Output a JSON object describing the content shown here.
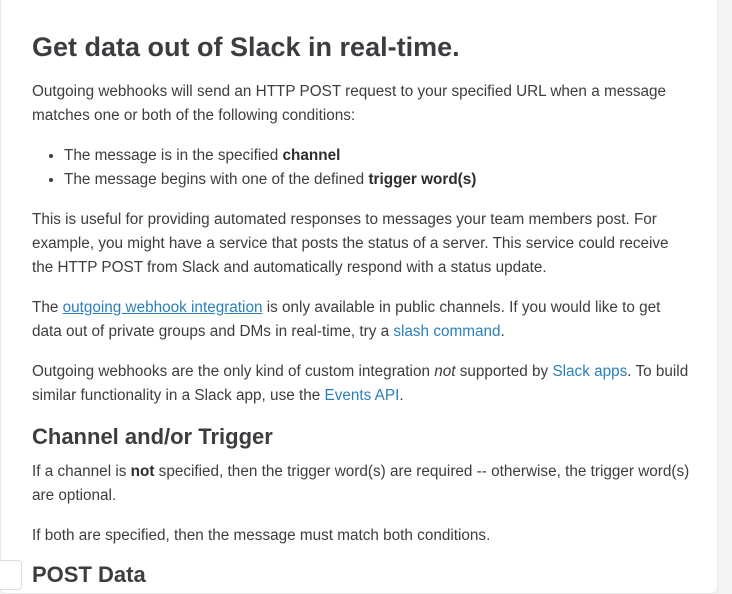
{
  "title": "Get data out of Slack in real-time.",
  "intro": "Outgoing webhooks will send an HTTP POST request to your specified URL when a message matches one or both of the following conditions:",
  "conditions": [
    {
      "prefix": "The message is in the specified ",
      "bold": "channel"
    },
    {
      "prefix": "The message begins with one of the defined ",
      "bold": "trigger word(s)"
    }
  ],
  "useful_text": "This is useful for providing automated responses to messages your team members post. For example, you might have a service that posts the status of a server. This service could receive the HTTP POST from Slack and automatically respond with a status update.",
  "availability": {
    "t1": "The ",
    "link1": "outgoing webhook integration",
    "t2": " is only available in public channels. If you would like to get data out of private groups and DMs in real-time, try a ",
    "link2": "slash command",
    "t3": "."
  },
  "apps": {
    "t1": "Outgoing webhooks are the only kind of custom integration ",
    "em": "not",
    "t2": " supported by ",
    "link1": "Slack apps",
    "t3": ". To build similar functionality in a Slack app, use the ",
    "link2": "Events API",
    "t4": "."
  },
  "section1": {
    "heading": "Channel and/or Trigger",
    "p1_t1": "If a channel is ",
    "p1_bold": "not",
    "p1_t2": " specified, then the trigger word(s) are required -- otherwise, the trigger word(s) are optional.",
    "p2": "If both are specified, then the message must match both conditions."
  },
  "section2": {
    "heading": "POST Data"
  },
  "colors": {
    "text": "#3d3c40",
    "link": "#2a80b9",
    "background": "#ffffff"
  }
}
